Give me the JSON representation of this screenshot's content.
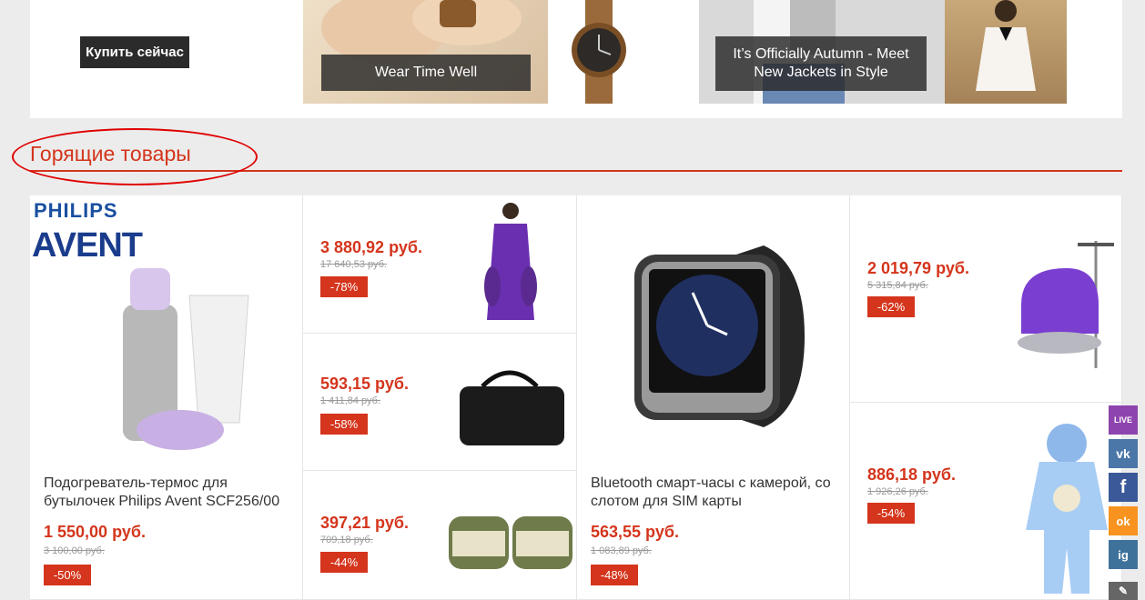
{
  "banner": {
    "buy_label": "Купить сейчас",
    "caption_1": "Wear Time Well",
    "caption_2": "It’s Officially Autumn - Meet New Jackets in Style"
  },
  "section": {
    "title": "Горящие товары"
  },
  "products": {
    "large_1": {
      "name": "Подогреватель-термос для бутылочек Philips Avent SCF256/00",
      "price": "1 550,00 руб.",
      "old_price": "3 100,00 руб.",
      "discount": "-50%",
      "brand_1": "PHILIPS",
      "brand_2": "AVENT"
    },
    "small_1": {
      "price": "3 880,92 руб.",
      "old_price": "17 640,53 руб.",
      "discount": "-78%"
    },
    "small_2": {
      "price": "593,15 руб.",
      "old_price": "1 411,84 руб.",
      "discount": "-58%"
    },
    "small_3": {
      "price": "397,21 руб.",
      "old_price": "709,18 руб.",
      "discount": "-44%"
    },
    "large_2": {
      "name": "Bluetooth смарт-часы с камерой, со слотом для SIM карты",
      "price": "563,55 руб.",
      "old_price": "1 083,89 руб.",
      "discount": "-48%"
    },
    "right_1": {
      "price": "2 019,79 руб.",
      "old_price": "5 315,84 руб.",
      "discount": "-62%"
    },
    "right_2": {
      "price": "886,18 руб.",
      "old_price": "1 926,26 руб.",
      "discount": "-54%"
    }
  },
  "social": {
    "live": "LIVE",
    "vk": "vk",
    "facebook": "f",
    "odnoklassniki": "ok",
    "instagram": "ig"
  },
  "colors": {
    "accent": "#d4351c",
    "vk": "#4a76a8",
    "facebook": "#3b5998",
    "ok": "#f7931e",
    "instagram": "#3f729b",
    "live": "#8e44ad"
  }
}
